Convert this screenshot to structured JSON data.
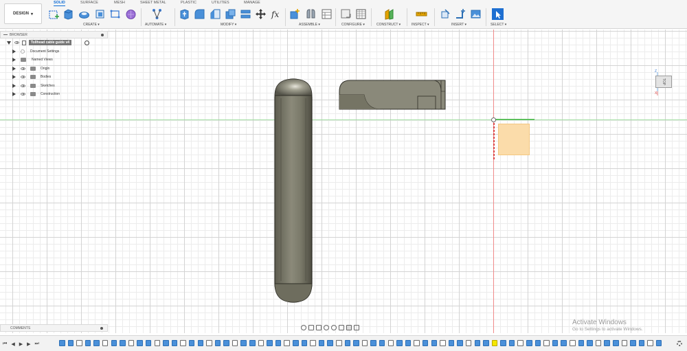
{
  "workspace_button": {
    "label": "DESIGN",
    "caret": "▾"
  },
  "tabs": [
    {
      "label": "SOLID",
      "active": true
    },
    {
      "label": "SURFACE",
      "active": false
    },
    {
      "label": "MESH",
      "active": false
    },
    {
      "label": "SHEET METAL",
      "active": false
    },
    {
      "label": "PLASTIC",
      "active": false
    },
    {
      "label": "UTILITIES",
      "active": false
    },
    {
      "label": "MANAGE",
      "active": false
    }
  ],
  "groups": {
    "create": "CREATE ▾",
    "automate": "AUTOMATE ▾",
    "modify": "MODIFY ▾",
    "assemble": "ASSEMBLE ▾",
    "configure": "CONFIGURE ▾",
    "construct": "CONSTRUCT ▾",
    "inspect": "INSPECT ▾",
    "insert": "INSERT ▾",
    "select": "SELECT ▾"
  },
  "browser": {
    "title": "BROWSER",
    "document": "Tollhead cable guide v4",
    "items": [
      {
        "label": "Document Settings"
      },
      {
        "label": "Named Views"
      },
      {
        "label": "Origin"
      },
      {
        "label": "Bodies"
      },
      {
        "label": "Sketches"
      },
      {
        "label": "Construction"
      }
    ]
  },
  "comments": {
    "label": "COMMENTS"
  },
  "viewcube": {
    "face": "TOP",
    "axis_z": "Z",
    "axis_x": "X"
  },
  "watermark": {
    "title": "Activate Windows",
    "subtitle": "Go to Settings to activate Windows."
  },
  "timeline": {
    "controls": [
      "⏮",
      "◀",
      "▶",
      "▶",
      "⏭"
    ],
    "highlighted_index": 50
  },
  "colors": {
    "accent": "#0a6ad6",
    "timeline_feature": "#4a90d9",
    "highlight": "#f5e700",
    "body": "#7b7a6a"
  }
}
